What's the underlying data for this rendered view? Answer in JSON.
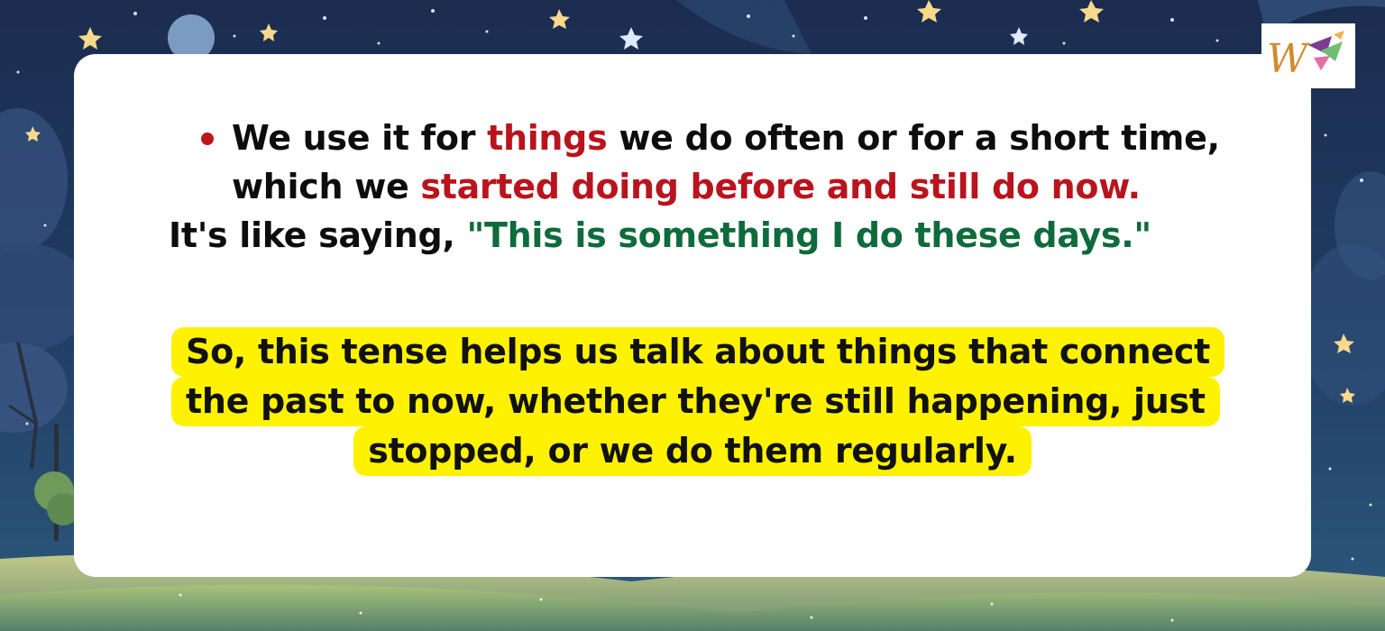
{
  "bullet": {
    "part1": "We use it for ",
    "part2": "things",
    "part3": " we do often or for a short time,",
    "part4": "which we ",
    "part5": "started doing before and still do now."
  },
  "saying": {
    "prefix": "It's like saying, ",
    "quote": "\"This is something I do these days.\""
  },
  "summary": {
    "line1": "So, this tense helps us talk about things that connect",
    "line2": "the past to now, whether they're still happening, just",
    "line3": "stopped, or we do them regularly."
  },
  "colors": {
    "emphasis_red": "#b9141d",
    "quote_green": "#0e6b3b",
    "highlight_yellow": "#fff200",
    "night_sky": "#1c3358"
  },
  "logo": {
    "icon": "w-logo-icon"
  }
}
